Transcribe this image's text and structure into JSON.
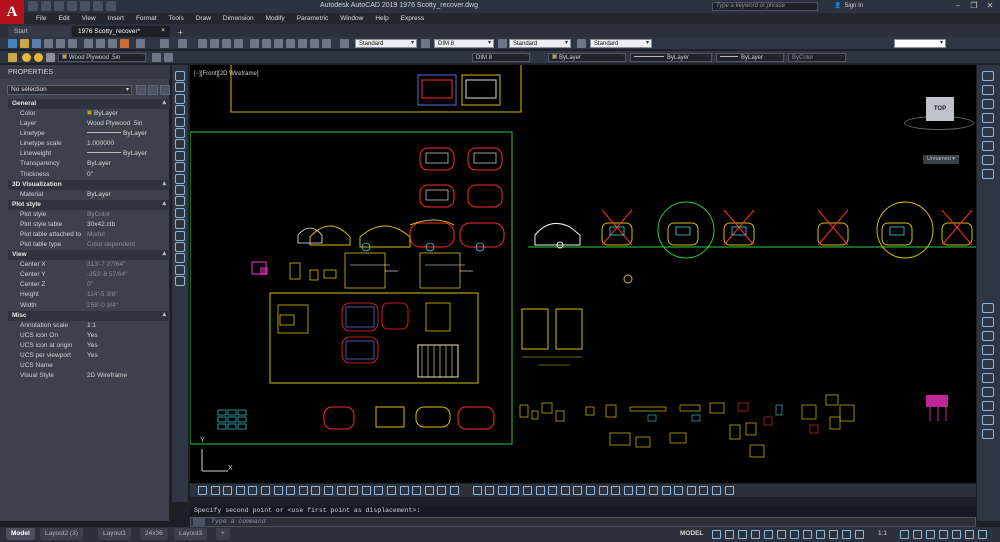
{
  "app": {
    "title": "Autodesk AutoCAD 2019   1976 Scotty_recover.dwg",
    "logo": "A",
    "search_placeholder": "Type a keyword or phrase",
    "sign_in": "Sign In"
  },
  "menu": [
    "File",
    "Edit",
    "View",
    "Insert",
    "Format",
    "Tools",
    "Draw",
    "Dimension",
    "Modify",
    "Parametric",
    "Window",
    "Help",
    "Express"
  ],
  "tabs": {
    "start": "Start",
    "document": "1976 Scotty_recover*",
    "close": "×",
    "add": "+"
  },
  "toolbar": {
    "text_style": "Standard",
    "dim_style": "DIM 8",
    "table_style": "Standard",
    "mleader_style": "Standard",
    "layer": "Wood Plywood .5in",
    "dim_style2": "DIM 8",
    "color": "ByLayer",
    "linetype": "ByLayer",
    "lineweight": "ByLayer",
    "plotstyle": "ByColor"
  },
  "properties": {
    "title": "PROPERTIES",
    "selection": "No selection",
    "sections": [
      {
        "name": "General",
        "rows": [
          {
            "k": "Color",
            "v": "ByLayer",
            "swatch": "#c8a000"
          },
          {
            "k": "Layer",
            "v": "Wood Plywood .5in"
          },
          {
            "k": "Linetype",
            "v": "ByLayer",
            "line": true
          },
          {
            "k": "Linetype scale",
            "v": "1.000000"
          },
          {
            "k": "Lineweight",
            "v": "ByLayer",
            "line": true
          },
          {
            "k": "Transparency",
            "v": "ByLayer"
          },
          {
            "k": "Thickness",
            "v": "0\""
          }
        ]
      },
      {
        "name": "3D Visualization",
        "rows": [
          {
            "k": "Material",
            "v": "ByLayer"
          }
        ]
      },
      {
        "name": "Plot style",
        "rows": [
          {
            "k": "Plot style",
            "v": "ByColor",
            "dim": true
          },
          {
            "k": "Plot style table",
            "v": "30x42.ctb"
          },
          {
            "k": "Plot table attached to",
            "v": "Model",
            "dim": true
          },
          {
            "k": "Plot table type",
            "v": "Color dependent",
            "dim": true
          }
        ]
      },
      {
        "name": "View",
        "rows": [
          {
            "k": "Center X",
            "v": "313'-7 27/64\"",
            "dim": true
          },
          {
            "k": "Center Y",
            "v": "-353'-8 57/64\"",
            "dim": true
          },
          {
            "k": "Center Z",
            "v": "0\"",
            "dim": true
          },
          {
            "k": "Height",
            "v": "114'-5 3/8\"",
            "dim": true
          },
          {
            "k": "Width",
            "v": "258'-0 3/4\"",
            "dim": true
          }
        ]
      },
      {
        "name": "Misc",
        "rows": [
          {
            "k": "Annotation scale",
            "v": "1:1"
          },
          {
            "k": "UCS icon On",
            "v": "Yes"
          },
          {
            "k": "UCS icon at origin",
            "v": "Yes"
          },
          {
            "k": "UCS per viewport",
            "v": "Yes"
          },
          {
            "k": "UCS Name",
            "v": ""
          },
          {
            "k": "Visual Style",
            "v": "2D Wireframe"
          }
        ]
      }
    ]
  },
  "viewport": {
    "label": "[−][Front][2D Wireframe]",
    "viewcube": "TOP",
    "wcs": "Unnamed ▾",
    "ucs_x": "X",
    "ucs_y": "Y"
  },
  "command": {
    "history": "Specify second point or <use first point as displacement>:",
    "placeholder": "Type a command"
  },
  "layout_tabs": [
    "Model",
    "Layout2 (3)",
    "Layout1",
    "24x36",
    "Layout3"
  ],
  "status": {
    "model": "MODEL",
    "scale": "1:1"
  },
  "colors": {
    "canvas": "#000000",
    "accent_red": "#b5121b",
    "cad_yellow": "#d4c000",
    "cad_green": "#2ecc40",
    "cad_red": "#ff2a2a",
    "cad_cyan": "#2fd5e6"
  }
}
